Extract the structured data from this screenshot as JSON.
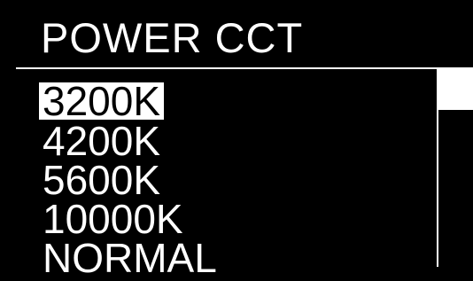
{
  "menu": {
    "title": "POWER CCT",
    "options": [
      {
        "label": "3200K",
        "selected": true
      },
      {
        "label": "4200K",
        "selected": false
      },
      {
        "label": "5600K",
        "selected": false
      },
      {
        "label": "10000K",
        "selected": false
      },
      {
        "label": "NORMAL",
        "selected": false
      }
    ]
  },
  "colors": {
    "background": "#000000",
    "foreground": "#ffffff",
    "highlight_text": "#000000"
  }
}
